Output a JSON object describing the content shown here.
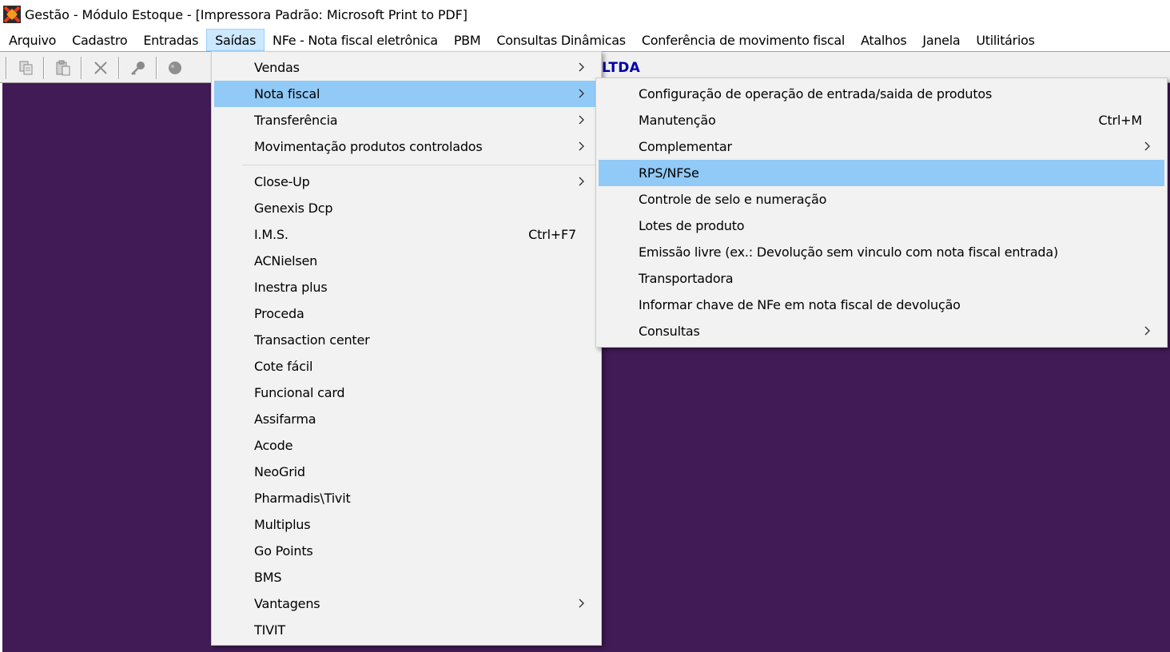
{
  "window": {
    "title": "Gestão  - Módulo Estoque - [Impressora Padrão: Microsoft Print to PDF]",
    "icon": "app-logo-icon"
  },
  "menubar": [
    {
      "label": "Arquivo",
      "active": false
    },
    {
      "label": "Cadastro",
      "active": false
    },
    {
      "label": "Entradas",
      "active": false
    },
    {
      "label": "Saídas",
      "active": true
    },
    {
      "label": "NFe - Nota fiscal eletrônica",
      "active": false
    },
    {
      "label": "PBM",
      "active": false
    },
    {
      "label": "Consultas Dinâmicas",
      "active": false
    },
    {
      "label": "Conferência de movimento fiscal",
      "active": false
    },
    {
      "label": "Atalhos",
      "active": false
    },
    {
      "label": "Janela",
      "active": false
    },
    {
      "label": "Utilitários",
      "active": false
    }
  ],
  "toolbar": {
    "buttons": [
      {
        "icon": "copy-icon"
      },
      {
        "icon": "paste-icon"
      },
      {
        "icon": "delete-icon"
      },
      {
        "icon": "key-icon"
      },
      {
        "icon": "circle-icon"
      }
    ],
    "company_text": "LTDA"
  },
  "saidas_menu": {
    "groups": [
      [
        {
          "label": "Vendas",
          "submenu": true,
          "highlighted": false,
          "shortcut": ""
        },
        {
          "label": "Nota fiscal",
          "submenu": true,
          "highlighted": true,
          "shortcut": ""
        },
        {
          "label": "Transferência",
          "submenu": true,
          "highlighted": false,
          "shortcut": ""
        },
        {
          "label": "Movimentação produtos controlados",
          "submenu": true,
          "highlighted": false,
          "shortcut": ""
        }
      ],
      [
        {
          "label": "Close-Up",
          "submenu": true,
          "highlighted": false,
          "shortcut": ""
        },
        {
          "label": "Genexis Dcp",
          "submenu": false,
          "highlighted": false,
          "shortcut": ""
        },
        {
          "label": "I.M.S.",
          "submenu": false,
          "highlighted": false,
          "shortcut": "Ctrl+F7"
        },
        {
          "label": "ACNielsen",
          "submenu": false,
          "highlighted": false,
          "shortcut": ""
        },
        {
          "label": "Inestra plus",
          "submenu": false,
          "highlighted": false,
          "shortcut": ""
        },
        {
          "label": "Proceda",
          "submenu": false,
          "highlighted": false,
          "shortcut": ""
        },
        {
          "label": "Transaction center",
          "submenu": false,
          "highlighted": false,
          "shortcut": ""
        },
        {
          "label": "Cote fácil",
          "submenu": false,
          "highlighted": false,
          "shortcut": ""
        },
        {
          "label": "Funcional card",
          "submenu": false,
          "highlighted": false,
          "shortcut": ""
        },
        {
          "label": "Assifarma",
          "submenu": false,
          "highlighted": false,
          "shortcut": ""
        },
        {
          "label": "Acode",
          "submenu": false,
          "highlighted": false,
          "shortcut": ""
        },
        {
          "label": "NeoGrid",
          "submenu": false,
          "highlighted": false,
          "shortcut": ""
        },
        {
          "label": "Pharmadis\\Tivit",
          "submenu": false,
          "highlighted": false,
          "shortcut": ""
        },
        {
          "label": "Multiplus",
          "submenu": false,
          "highlighted": false,
          "shortcut": ""
        },
        {
          "label": "Go Points",
          "submenu": false,
          "highlighted": false,
          "shortcut": ""
        },
        {
          "label": "BMS",
          "submenu": false,
          "highlighted": false,
          "shortcut": ""
        },
        {
          "label": "Vantagens",
          "submenu": true,
          "highlighted": false,
          "shortcut": ""
        },
        {
          "label": "TIVIT",
          "submenu": false,
          "highlighted": false,
          "shortcut": ""
        }
      ]
    ]
  },
  "nota_fiscal_menu": {
    "items": [
      {
        "label": "Configuração de operação de entrada/saida de produtos",
        "submenu": false,
        "highlighted": false,
        "shortcut": ""
      },
      {
        "label": "Manutenção",
        "submenu": false,
        "highlighted": false,
        "shortcut": "Ctrl+M"
      },
      {
        "label": "Complementar",
        "submenu": true,
        "highlighted": false,
        "shortcut": ""
      },
      {
        "label": "RPS/NFSe",
        "submenu": false,
        "highlighted": true,
        "shortcut": ""
      },
      {
        "label": "Controle de selo e numeração",
        "submenu": false,
        "highlighted": false,
        "shortcut": ""
      },
      {
        "label": "Lotes de produto",
        "submenu": false,
        "highlighted": false,
        "shortcut": ""
      },
      {
        "label": "Emissão livre (ex.: Devolução sem vinculo com nota fiscal entrada)",
        "submenu": false,
        "highlighted": false,
        "shortcut": ""
      },
      {
        "label": "Transportadora",
        "submenu": false,
        "highlighted": false,
        "shortcut": ""
      },
      {
        "label": "Informar chave de NFe em nota fiscal de devolução",
        "submenu": false,
        "highlighted": false,
        "shortcut": ""
      },
      {
        "label": "Consultas",
        "submenu": true,
        "highlighted": false,
        "shortcut": ""
      }
    ]
  },
  "colors": {
    "workspace": "#411b55",
    "highlight": "#91c9f7",
    "menu_bg": "#f2f2f2",
    "company_text": "#0000aa",
    "logo_accent": "#e8391c"
  }
}
